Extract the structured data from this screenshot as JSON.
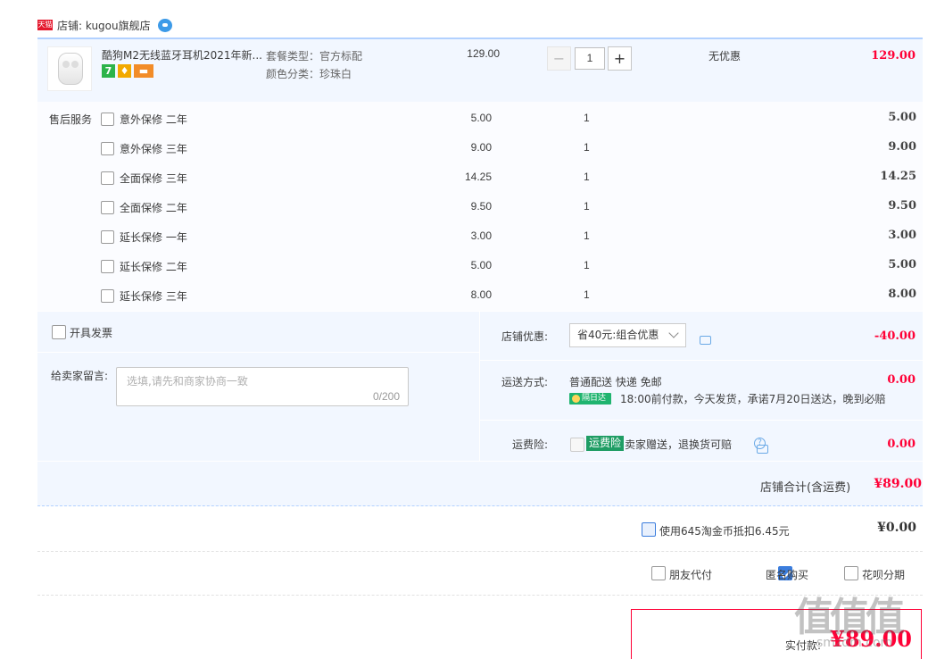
{
  "store": {
    "badge": "天猫",
    "label": "店铺: kugou旗舰店"
  },
  "item": {
    "title": "酷狗M2无线蓝牙耳机2021年新...",
    "package_type": "套餐类型：官方标配",
    "color": "颜色分类：珍珠白",
    "price": "129.00",
    "quantity": "1",
    "minus": "−",
    "plus": "+",
    "discount": "无优惠",
    "subtotal": "129.00",
    "badges": [
      {
        "text": "7",
        "color": "#2cb34a"
      },
      {
        "text": "♦",
        "color": "#f2a900"
      },
      {
        "text": "▬",
        "color": "#f28c28"
      }
    ]
  },
  "services": {
    "label": "售后服务",
    "rows": [
      {
        "name": "意外保修 二年",
        "price": "5.00",
        "qty": "1",
        "total": "5.00"
      },
      {
        "name": "意外保修 三年",
        "price": "9.00",
        "qty": "1",
        "total": "9.00"
      },
      {
        "name": "全面保修 三年",
        "price": "14.25",
        "qty": "1",
        "total": "14.25"
      },
      {
        "name": "全面保修 二年",
        "price": "9.50",
        "qty": "1",
        "total": "9.50"
      },
      {
        "name": "延长保修 一年",
        "price": "3.00",
        "qty": "1",
        "total": "3.00"
      },
      {
        "name": "延长保修 二年",
        "price": "5.00",
        "qty": "1",
        "total": "5.00"
      },
      {
        "name": "延长保修 三年",
        "price": "8.00",
        "qty": "1",
        "total": "8.00"
      }
    ]
  },
  "invoice": {
    "label": "开具发票"
  },
  "message": {
    "label": "给卖家留言:",
    "placeholder": "选填,请先和商家协商一致",
    "count": "0/200"
  },
  "store_promo": {
    "label": "店铺优惠:",
    "selected": "省40元:组合优惠",
    "amount": "-40.00"
  },
  "shipping": {
    "label": "运送方式:",
    "method": "普通配送 快递 免邮",
    "badge": "隔日达",
    "note": "18:00前付款，今天发货，承诺7月20日送达，晚到必赔",
    "amount": "0.00"
  },
  "insurance": {
    "label": "运费险:",
    "tag": "运费险",
    "note": "卖家赠送，退换货可赔",
    "amount": "0.00"
  },
  "store_total": {
    "label": "店铺合计(含运费)",
    "amount": "¥89.00"
  },
  "coins": {
    "label": "使用645淘金币抵扣6.45元",
    "amount": "¥0.00"
  },
  "options": {
    "friend_pay": "朋友代付",
    "anonymous": "匿名购买",
    "huabei": "花呗分期"
  },
  "payment": {
    "label": "实付款:",
    "amount": "¥89.00"
  },
  "watermark": {
    "text": "值值值",
    "sub": "smzdm.com"
  }
}
